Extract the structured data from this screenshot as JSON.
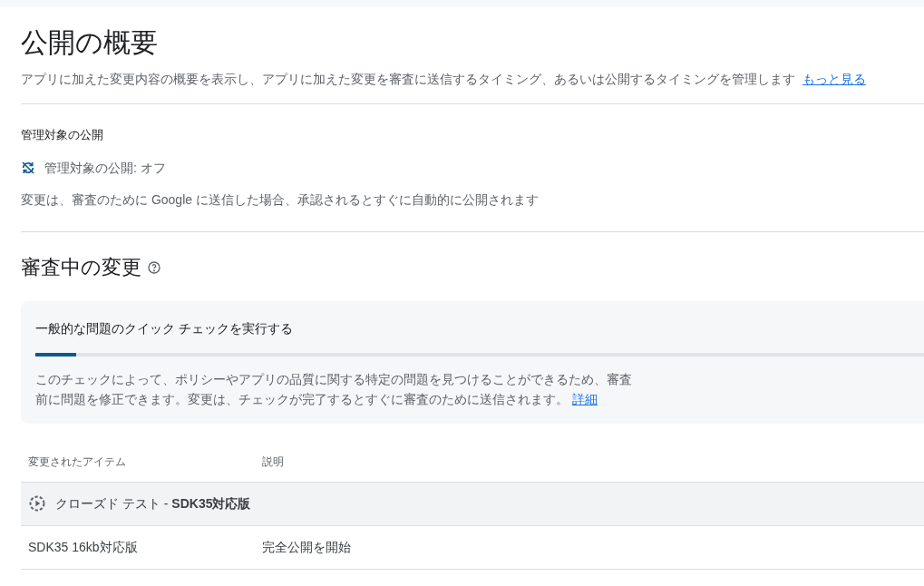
{
  "page": {
    "title": "公開の概要",
    "description": "アプリに加えた変更内容の概要を表示し、アプリに加えた変更を審査に送信するタイミング、あるいは公開するタイミングを管理します",
    "learn_more_link": "もっと見る"
  },
  "managed_publishing": {
    "heading": "管理対象の公開",
    "status": "管理対象の公開: オフ",
    "on": false,
    "note": "変更は、審査のために Google に送信した場合、承認されるとすぐに自動的に公開されます"
  },
  "in_review": {
    "heading": "審査中の変更",
    "quick_check": {
      "title": "一般的な問題のクイック チェックを実行する",
      "level": 0.046,
      "description": "このチェックによって、ポリシーやアプリの品質に関する特定の問題を見つけることができるため、審査前に問題を修正できます。変更は、チェックが完了するとすぐに審査のために送信されます。",
      "link": "詳細"
    },
    "table": {
      "columns": [
        "変更されたアイテム",
        "説明"
      ],
      "groups": [
        {
          "title": "クローズド テスト - **SDK35対応版**",
          "rows": [
            {
              "item": "SDK35 16kb対応版",
              "description": "完全公開を開始"
            }
          ]
        }
      ]
    }
  }
}
